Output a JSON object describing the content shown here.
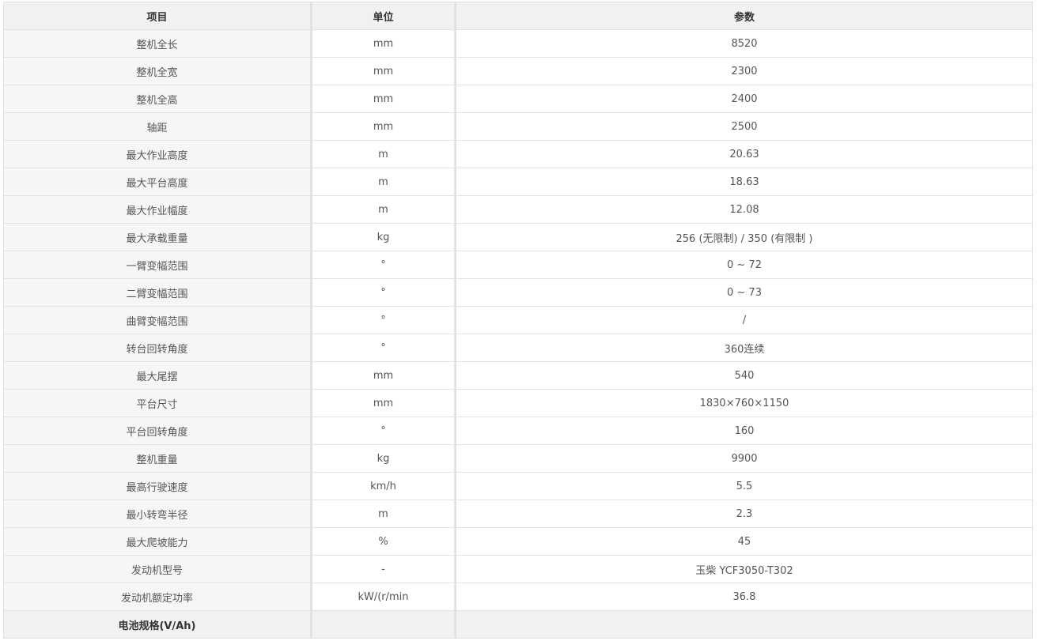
{
  "table": {
    "headers": [
      "项目",
      "单位",
      "参数"
    ],
    "rows": [
      [
        "整机全长",
        "mm",
        "8520"
      ],
      [
        "整机全宽",
        "mm",
        "2300"
      ],
      [
        "整机全高",
        "mm",
        "2400"
      ],
      [
        "轴距",
        "mm",
        "2500"
      ],
      [
        "最大作业高度",
        "m",
        "20.63"
      ],
      [
        "最大平台高度",
        "m",
        "18.63"
      ],
      [
        "最大作业幅度",
        "m",
        "12.08"
      ],
      [
        "最大承载重量",
        "kg",
        "256 (无限制) / 350 (有限制 )"
      ],
      [
        "一臂变幅范围",
        "°",
        "0 ~ 72"
      ],
      [
        "二臂变幅范围",
        "°",
        "0 ~ 73"
      ],
      [
        "曲臂变幅范围",
        "°",
        "/"
      ],
      [
        "转台回转角度",
        "°",
        "360连续"
      ],
      [
        "最大尾摆",
        "mm",
        "540"
      ],
      [
        "平台尺寸",
        "mm",
        "1830×760×1150"
      ],
      [
        "平台回转角度",
        "°",
        "160"
      ],
      [
        "整机重量",
        "kg",
        "9900"
      ],
      [
        "最高行驶速度",
        "km/h",
        "5.5"
      ],
      [
        "最小转弯半径",
        "m",
        "2.3"
      ],
      [
        "最大爬坡能力",
        "%",
        "45"
      ],
      [
        "发动机型号",
        "-",
        "玉柴 YCF3050-T302"
      ],
      [
        "发动机额定功率",
        "kW/(r/min",
        "36.8"
      ],
      [
        "电池规格(V/Ah)",
        "",
        ""
      ]
    ]
  }
}
